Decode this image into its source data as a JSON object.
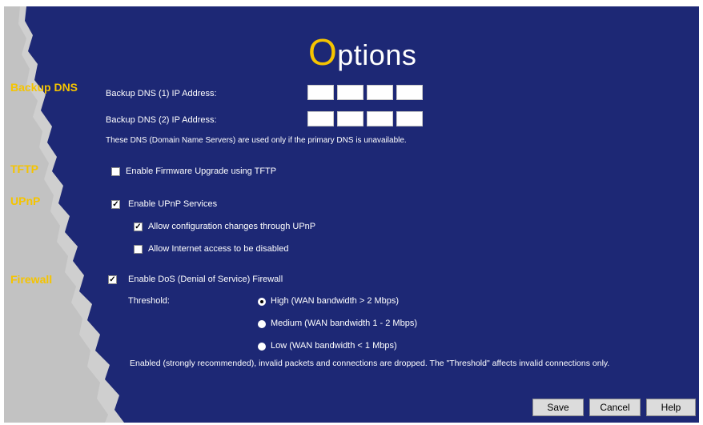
{
  "page": {
    "title_first_letter": "O",
    "title_rest": "ptions"
  },
  "sections": {
    "backup_dns": "Backup DNS",
    "tftp": "TFTP",
    "upnp": "UPnP",
    "firewall": "Firewall"
  },
  "backup_dns": {
    "dns1_label": "Backup DNS (1) IP Address:",
    "dns2_label": "Backup DNS (2) IP Address:",
    "dns1_octets": [
      "",
      "",
      "",
      ""
    ],
    "dns2_octets": [
      "",
      "",
      "",
      ""
    ],
    "note": "These DNS (Domain Name Servers) are used only if the primary DNS is unavailable."
  },
  "tftp": {
    "enable_label": "Enable Firmware Upgrade using TFTP",
    "enable_checked": false
  },
  "upnp": {
    "enable_label": "Enable UPnP Services",
    "enable_checked": true,
    "allow_config_label": "Allow configuration changes through UPnP",
    "allow_config_checked": true,
    "allow_disable_label": "Allow Internet access to be disabled",
    "allow_disable_checked": false
  },
  "firewall": {
    "enable_label": "Enable DoS (Denial of Service) Firewall",
    "enable_checked": true,
    "threshold_label": "Threshold:",
    "options": [
      "High (WAN bandwidth > 2 Mbps)",
      "Medium (WAN bandwidth 1 - 2 Mbps)",
      "Low (WAN bandwidth < 1 Mbps)"
    ],
    "selected_option": 0,
    "note": "Enabled (strongly recommended), invalid packets and connections are dropped. The \"Threshold\" affects invalid connections only."
  },
  "buttons": {
    "save": "Save",
    "cancel": "Cancel",
    "help": "Help"
  },
  "colors": {
    "background": "#1d2875",
    "accent": "#f5c400",
    "torn_edge": "#c8c8c8"
  }
}
